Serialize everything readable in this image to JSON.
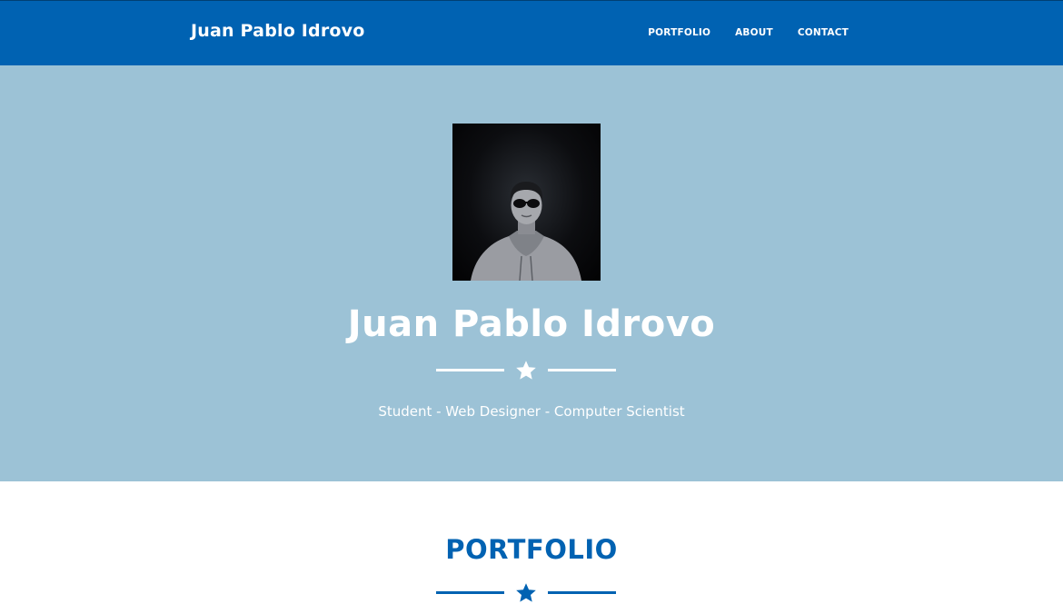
{
  "navbar": {
    "brand": "Juan Pablo Idrovo",
    "links": [
      "PORTFOLIO",
      "ABOUT",
      "CONTACT"
    ]
  },
  "masthead": {
    "title": "Juan Pablo Idrovo",
    "subtitle": "Student - Web Designer - Computer Scientist",
    "divider_icon": "star-icon"
  },
  "portfolio": {
    "heading": "PORTFOLIO",
    "divider_icon": "star-icon"
  },
  "colors": {
    "navbar_bg": "#0062b2",
    "masthead_bg": "#9cc2d6",
    "accent": "#0062b2",
    "text_light": "#ffffff"
  }
}
